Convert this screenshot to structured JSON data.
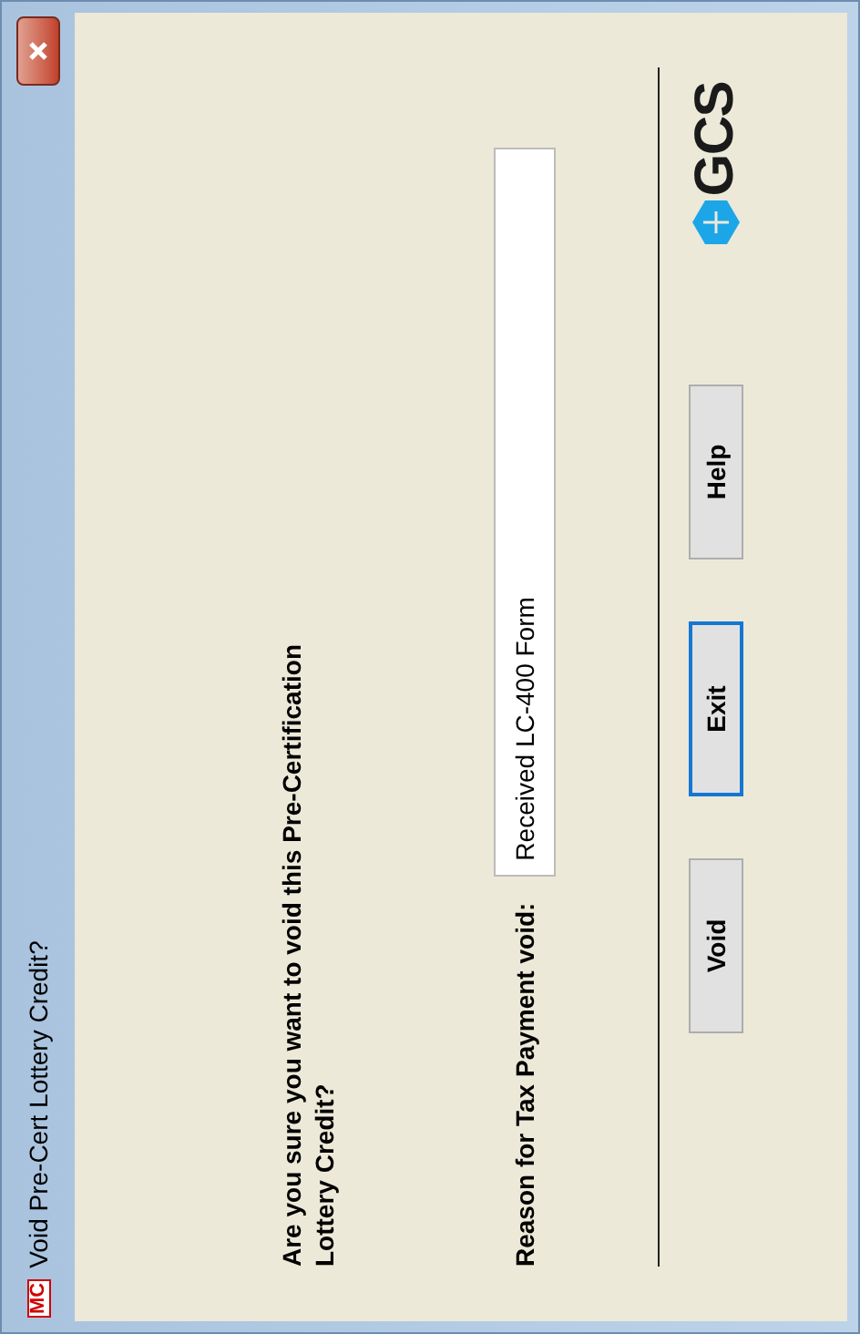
{
  "window": {
    "icon_text": "MC",
    "title": "Void Pre-Cert Lottery Credit?"
  },
  "question": "Are you sure you want to void this Pre-Certification Lottery Credit?",
  "reason": {
    "label": "Reason for Tax Payment void:",
    "value": "Received LC-400 Form"
  },
  "buttons": [
    {
      "label": "Void",
      "focused": false
    },
    {
      "label": "Exit",
      "focused": true
    },
    {
      "label": "Help",
      "focused": false
    }
  ],
  "logo": {
    "text": "GCS"
  }
}
